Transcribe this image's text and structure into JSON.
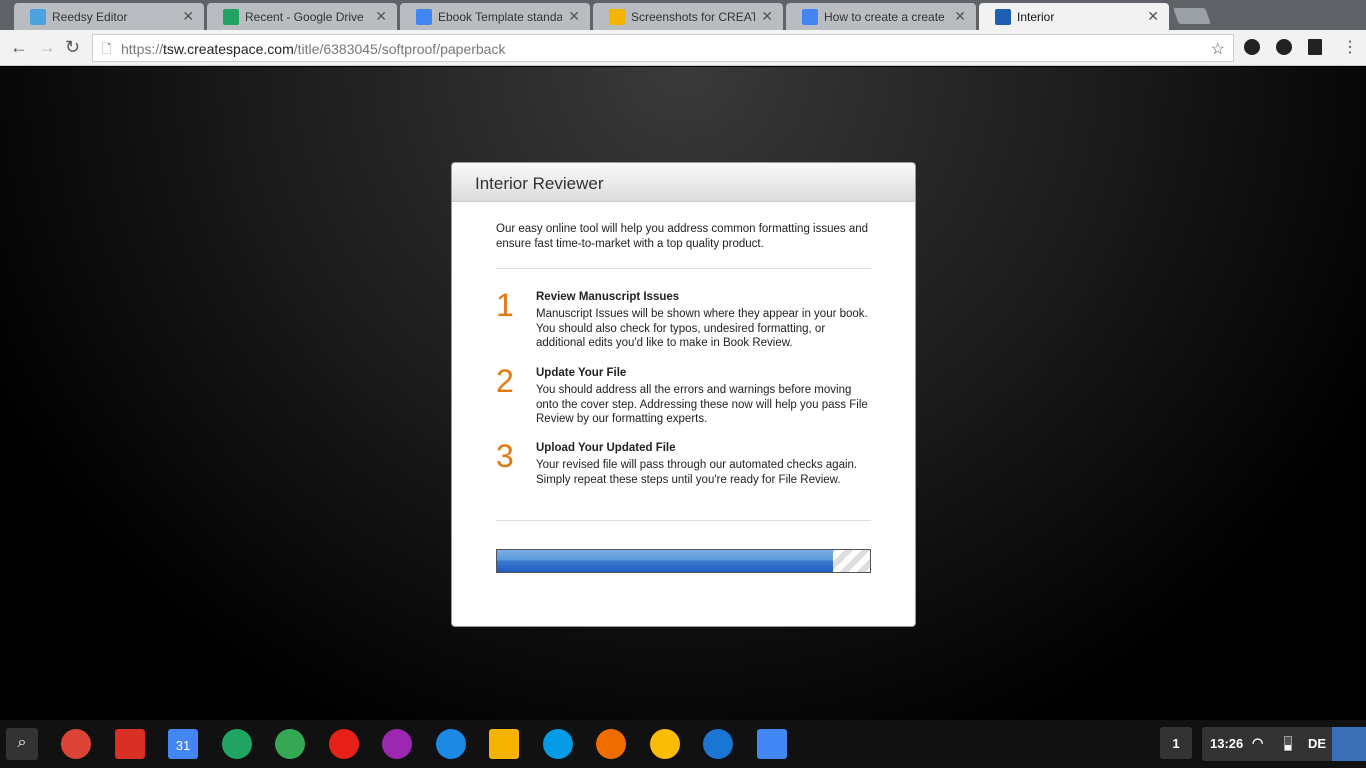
{
  "tabs": [
    {
      "title": "Reedsy Editor",
      "icon": "reedsy-icon",
      "color": "#4aa3df"
    },
    {
      "title": "Recent - Google Drive",
      "icon": "google-drive-icon",
      "color": "#1fa463"
    },
    {
      "title": "Ebook Template standar",
      "icon": "google-docs-icon",
      "color": "#4285f4"
    },
    {
      "title": "Screenshots for CREATE",
      "icon": "google-slides-icon",
      "color": "#f4b400"
    },
    {
      "title": "How to create a create s",
      "icon": "google-docs-icon",
      "color": "#4285f4"
    },
    {
      "title": "Interior",
      "icon": "createspace-icon",
      "color": "#1e5fb4"
    }
  ],
  "address": {
    "scheme": "https://",
    "host": "tsw.createspace.com",
    "path": "/title/6383045/softproof/paperback"
  },
  "dialog": {
    "title": "Interior Reviewer",
    "intro": "Our easy online tool will help you address common formatting issues and ensure fast time-to-market with a top quality product.",
    "steps": [
      {
        "num": "1",
        "title": "Review Manuscript Issues",
        "text": "Manuscript Issues will be shown where they appear in your book. You should also check for typos, undesired formatting, or additional edits you'd like to make in Book Review."
      },
      {
        "num": "2",
        "title": "Update Your File",
        "text": "You should address all the errors and warnings before moving onto the cover step. Addressing these now will help you pass File Review by our formatting experts."
      },
      {
        "num": "3",
        "title": "Upload Your Updated File",
        "text": "Your revised file will pass through our automated checks again. Simply repeat these steps until you're ready for File Review."
      }
    ],
    "progress_percent": 90,
    "accent": "#e47911"
  },
  "shelf": {
    "apps": [
      {
        "name": "chrome-icon",
        "color": "#db4437"
      },
      {
        "name": "gmail-icon",
        "color": "#d93025"
      },
      {
        "name": "calendar-icon",
        "color": "#4285f4",
        "label": "31"
      },
      {
        "name": "google-drive-icon",
        "color": "#1fa463"
      },
      {
        "name": "maps-icon",
        "color": "#34a853"
      },
      {
        "name": "youtube-icon",
        "color": "#e62117"
      },
      {
        "name": "picasa-icon",
        "color": "#9c27b0"
      },
      {
        "name": "files-icon",
        "color": "#1e88e5"
      },
      {
        "name": "keep-icon",
        "color": "#f6b400"
      },
      {
        "name": "camera-icon",
        "color": "#039be5"
      },
      {
        "name": "play-music-icon",
        "color": "#ef6c00"
      },
      {
        "name": "photos-icon",
        "color": "#fbbc05"
      },
      {
        "name": "contacts-icon",
        "color": "#1976d2"
      },
      {
        "name": "docs-icon",
        "color": "#4285f4"
      }
    ],
    "workspace": "1",
    "time": "13:26",
    "keyboard": "DE"
  }
}
